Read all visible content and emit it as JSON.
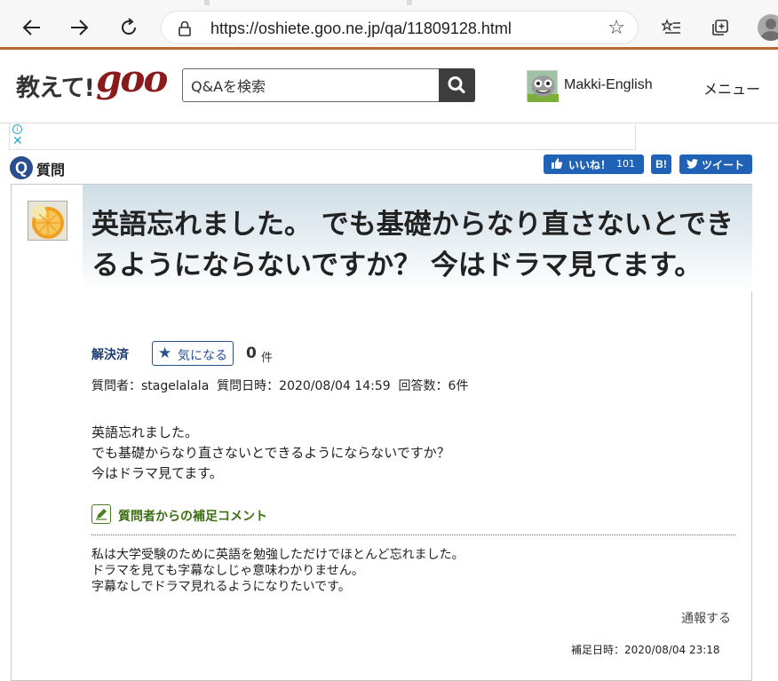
{
  "browser": {
    "url": "https://oshiete.goo.ne.jp/qa/11809128.html"
  },
  "header": {
    "logo_jp": "教えて!",
    "logo_goo": "goo",
    "search_placeholder": "Q&Aを検索",
    "username": "Makki-English",
    "menu_label": "メニュー"
  },
  "question_bar": {
    "icon_letter": "Q",
    "label": "質問",
    "like_label": "いいね！",
    "like_count": "101",
    "hatena_label": "B!",
    "tweet_label": "ツイート"
  },
  "question": {
    "title": "英語忘れました。 でも基礎からなり直さないとできるようにならないですか？ 今はドラマ見てます。",
    "status": "解決済",
    "watch_label": "気になる",
    "watch_count": "0",
    "watch_unit": "件",
    "meta": "質問者：stagelalala  質問日時：2020/08/04 14:59  回答数：6件",
    "body_lines": [
      "英語忘れました。",
      "でも基礎からなり直さないとできるようにならないですか？",
      "今はドラマ見てます。"
    ],
    "supplement_heading": "質問者からの補足コメント",
    "supplement_lines": [
      "私は大学受験のために英語を勉強しただけでほとんど忘れました。",
      "ドラマを見ても字幕なしじゃ意味わかりません。",
      "字幕なしでドラマ見れるようになりたいです。"
    ],
    "report_label": "通報する",
    "supplement_date": "補足日時：2020/08/04 23:18"
  },
  "colors": {
    "accent_bar": "#b8682e",
    "brand_blue": "#1f62b6",
    "goo_red": "#8b1a1a",
    "supplement_green": "#3d6f14"
  }
}
